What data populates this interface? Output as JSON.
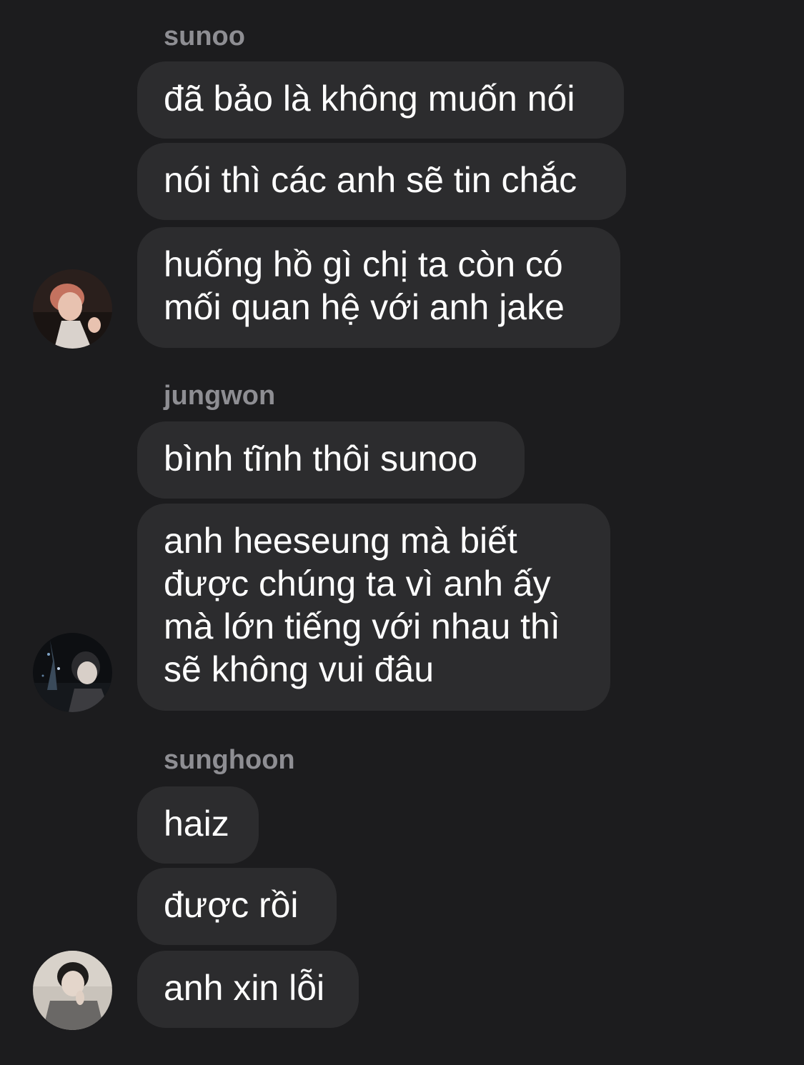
{
  "theme": {
    "background": "#1c1c1e",
    "bubble": "#2c2c2e",
    "sender_name": "#8e8e93",
    "text": "#ffffff"
  },
  "groups": [
    {
      "sender": "sunoo",
      "avatar_icon": "sunoo-avatar-photo",
      "messages": [
        {
          "lines": [
            "đã bảo là không muốn nói"
          ]
        },
        {
          "lines": [
            "nói thì các anh sẽ tin chắc"
          ]
        },
        {
          "lines": [
            "huống hồ gì chị ta còn có",
            "mối quan hệ với anh jake"
          ]
        }
      ]
    },
    {
      "sender": "jungwon",
      "avatar_icon": "jungwon-avatar-photo",
      "messages": [
        {
          "lines": [
            "bình tĩnh thôi sunoo"
          ]
        },
        {
          "lines": [
            "anh heeseung mà biết",
            "được chúng ta vì anh ấy",
            "mà lớn tiếng với nhau thì",
            "sẽ không vui đâu"
          ]
        }
      ]
    },
    {
      "sender": "sunghoon",
      "avatar_icon": "sunghoon-avatar-photo",
      "messages": [
        {
          "lines": [
            "haiz"
          ]
        },
        {
          "lines": [
            "được rồi"
          ]
        },
        {
          "lines": [
            "anh xin lỗi"
          ]
        }
      ]
    }
  ]
}
